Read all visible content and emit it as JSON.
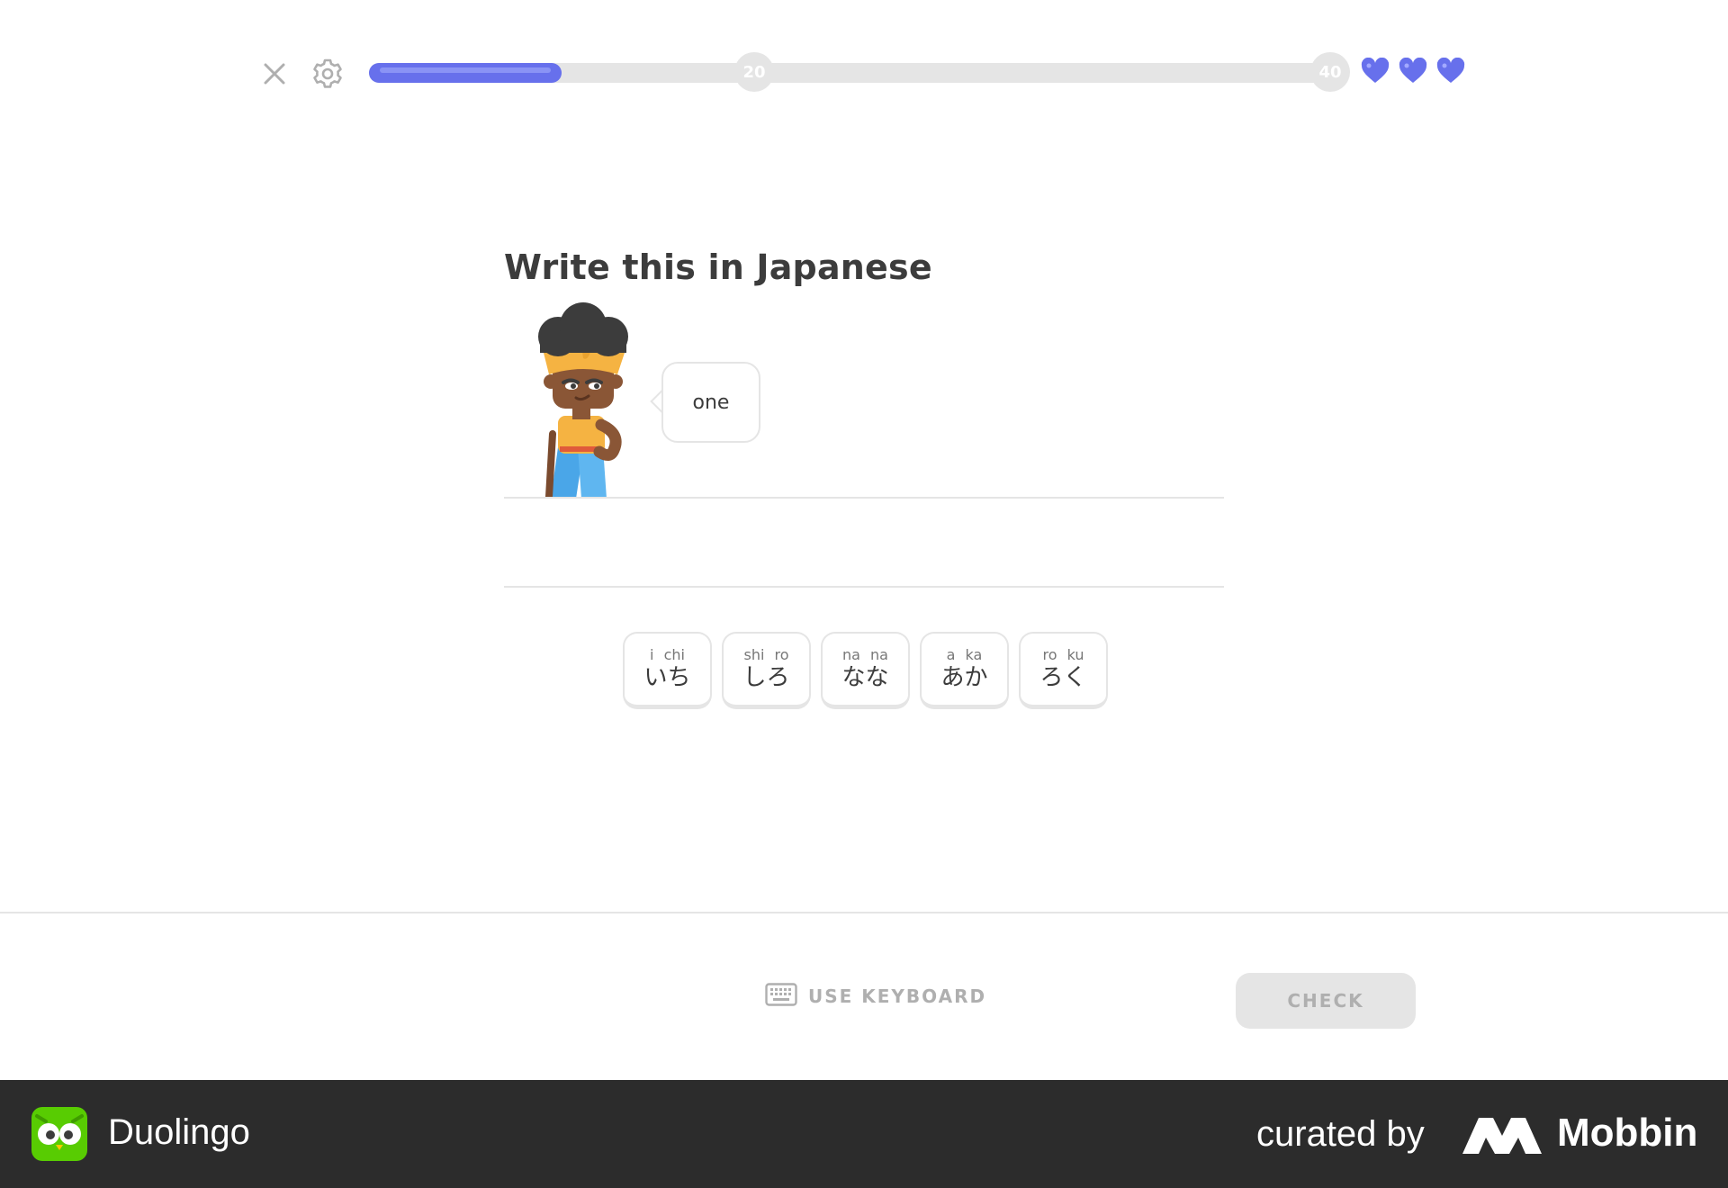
{
  "header": {
    "progress_fraction": 0.2,
    "milestones": [
      "20",
      "40"
    ],
    "hearts": 3,
    "accent_color": "#6770ec",
    "icons": [
      "close-icon",
      "gear-icon",
      "heart-icon"
    ]
  },
  "challenge": {
    "prompt": "Write this in Japanese",
    "bubble_text": "one"
  },
  "word_bank": [
    {
      "romaji": "i chi",
      "kana": "いち"
    },
    {
      "romaji": "shi ro",
      "kana": "しろ"
    },
    {
      "romaji": "na na",
      "kana": "なな"
    },
    {
      "romaji": "a ka",
      "kana": "あか"
    },
    {
      "romaji": "ro ku",
      "kana": "ろく"
    }
  ],
  "footer": {
    "keyboard_label": "USE KEYBOARD",
    "check_label": "CHECK",
    "keyboard_icon": "keyboard-icon"
  },
  "branding": {
    "app_name": "Duolingo",
    "curated_by": "curated by",
    "mobbin": "Mobbin"
  }
}
